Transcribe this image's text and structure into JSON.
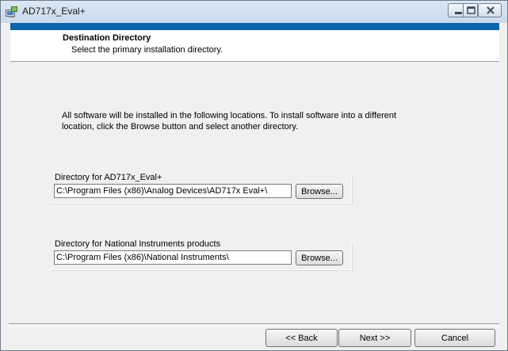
{
  "window": {
    "title": "AD717x_Eval+",
    "app_icon": "installer-icon",
    "controls": [
      "minimize-icon",
      "maximize-icon",
      "close-icon"
    ]
  },
  "header": {
    "title": "Destination Directory",
    "subtitle": "Select the primary installation directory."
  },
  "body": {
    "line1": "All software will be installed in the following locations. To install software into a different",
    "line2": "location, click the Browse button and select another directory."
  },
  "directories": [
    {
      "label": "Directory for AD717x_Eval+",
      "value": "C:\\Program Files (x86)\\Analog Devices\\AD717x Eval+\\",
      "browse_label": "Browse..."
    },
    {
      "label": "Directory for National Instruments products",
      "value": "C:\\Program Files (x86)\\National Instruments\\",
      "browse_label": "Browse..."
    }
  ],
  "footer": {
    "back_label": "<< Back",
    "next_label": "Next >>",
    "cancel_label": "Cancel"
  }
}
